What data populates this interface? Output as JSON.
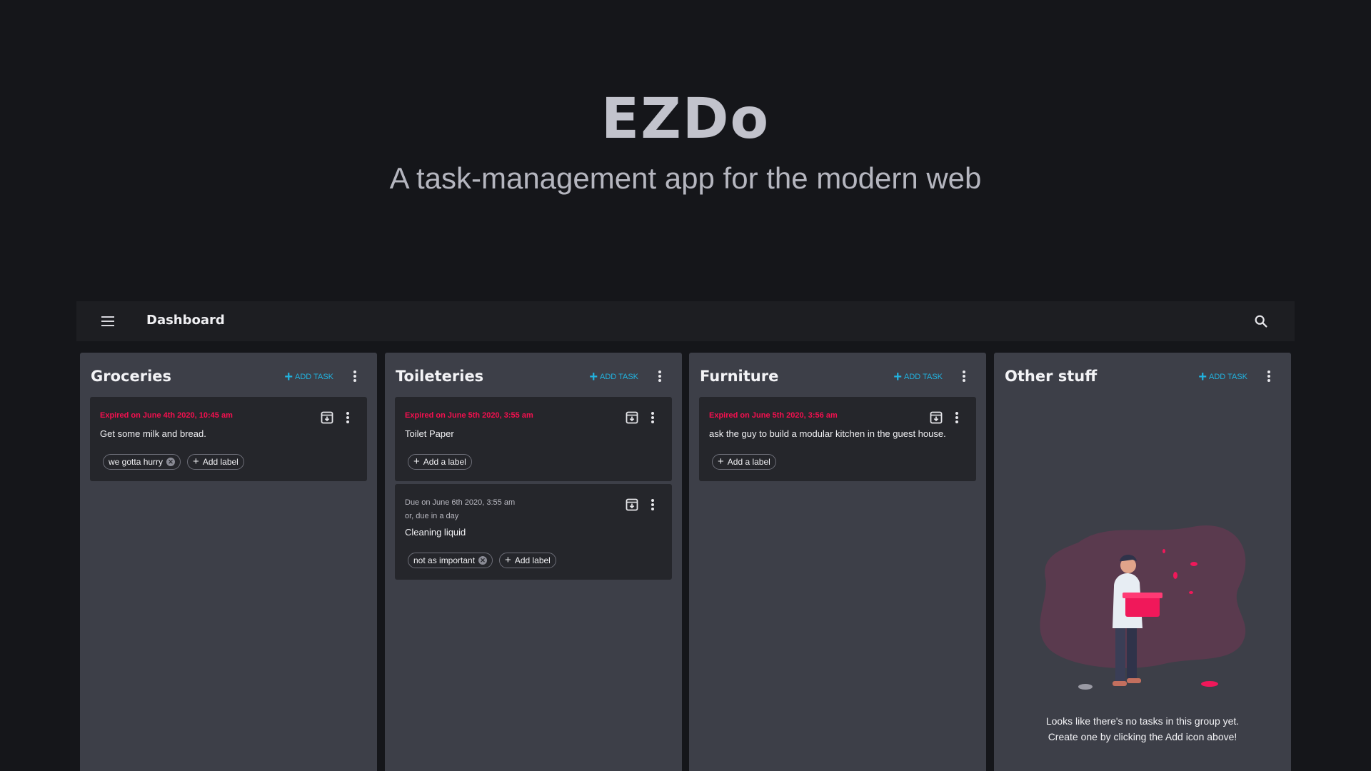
{
  "hero": {
    "title": "EZDo",
    "subtitle": "A task-management app for the modern web"
  },
  "appbar": {
    "title": "Dashboard",
    "menu_icon": "hamburger-menu-icon",
    "search_icon": "search-icon"
  },
  "colors": {
    "page_bg": "#15161a",
    "column_bg": "#3d3f48",
    "card_bg": "#25262b",
    "accent": "#21b3e0",
    "expired": "#f50f4f"
  },
  "columns": [
    {
      "title": "Groceries",
      "add_task_label": "ADD TASK",
      "cards": [
        {
          "status": "Expired on June 4th 2020, 10:45 am",
          "text": "Get some milk and bread.",
          "labels": [
            "we gotta hurry"
          ],
          "add_label": "Add label"
        }
      ]
    },
    {
      "title": "Toileteries",
      "add_task_label": "ADD TASK",
      "cards": [
        {
          "status": "Expired on June 5th 2020, 3:55 am",
          "text": "Toilet Paper",
          "labels": [],
          "add_label": "Add a label"
        },
        {
          "status": "Due on June 6th 2020, 3:55 am",
          "sub": "or, due in a day",
          "text": "Cleaning liquid",
          "labels": [
            "not as important"
          ],
          "add_label": "Add label"
        }
      ]
    },
    {
      "title": "Furniture",
      "add_task_label": "ADD TASK",
      "cards": [
        {
          "status": "Expired on June 5th 2020, 3:56 am",
          "text": "ask the guy to build a modular kitchen in the guest house.",
          "labels": [],
          "add_label": "Add a label"
        }
      ]
    },
    {
      "title": "Other stuff",
      "add_task_label": "ADD TASK",
      "cards": [],
      "empty_line1": "Looks like there's no tasks in this group yet.",
      "empty_line2": "Create one by clicking the Add icon above!"
    }
  ]
}
